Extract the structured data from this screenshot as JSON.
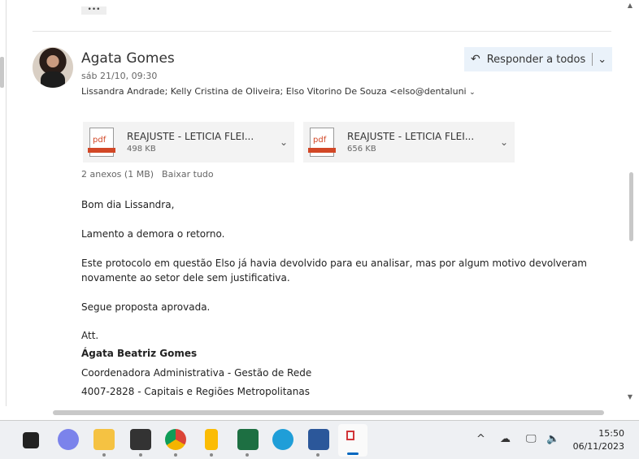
{
  "toolbar": {
    "more_label": "•••"
  },
  "message": {
    "sender": "Agata Gomes",
    "date": "sáb 21/10, 09:30",
    "recipients": "Lissandra Andrade; Kelly Cristina de Oliveira; Elso Vitorino De Souza <elso@dentaluni",
    "reply_all_label": "Responder a todos",
    "attachments": [
      {
        "name": "REAJUSTE - LETICIA FLEI...",
        "size": "498 KB",
        "icon": "pdf-icon"
      },
      {
        "name": "REAJUSTE - LETICIA FLEI...",
        "size": "656 KB",
        "icon": "pdf-icon"
      }
    ],
    "attachments_summary": "2 anexos (1 MB)",
    "download_all": "Baixar tudo",
    "body": [
      "Bom dia Lissandra,",
      "Lamento a demora o retorno.",
      "Este protocolo em questão Elso já havia devolvido para eu analisar, mas por algum motivo devolveram",
      "novamente ao setor dele sem justificativa.",
      "Segue proposta aprovada.",
      "Att."
    ],
    "signature": {
      "name": "Ágata Beatriz Gomes",
      "title": "Coordenadora Administrativa -  Gestão de Rede",
      "phone": "4007-2828 - Capitais e Regiões Metropolitanas"
    }
  },
  "taskbar": {
    "time": "15:50",
    "date": "06/11/2023",
    "apps": [
      "task-view",
      "teams",
      "file-explorer",
      "sticky-notes",
      "chrome",
      "keep",
      "excel",
      "edge",
      "word",
      "snipping-tool"
    ],
    "colors": {
      "teams": "#7b83eb",
      "explorer": "#f5c242",
      "chrome": "#db4437",
      "excel": "#1d6f42",
      "edge": "#1f9ed8",
      "word": "#2b579a",
      "snip": "#d13438"
    }
  }
}
